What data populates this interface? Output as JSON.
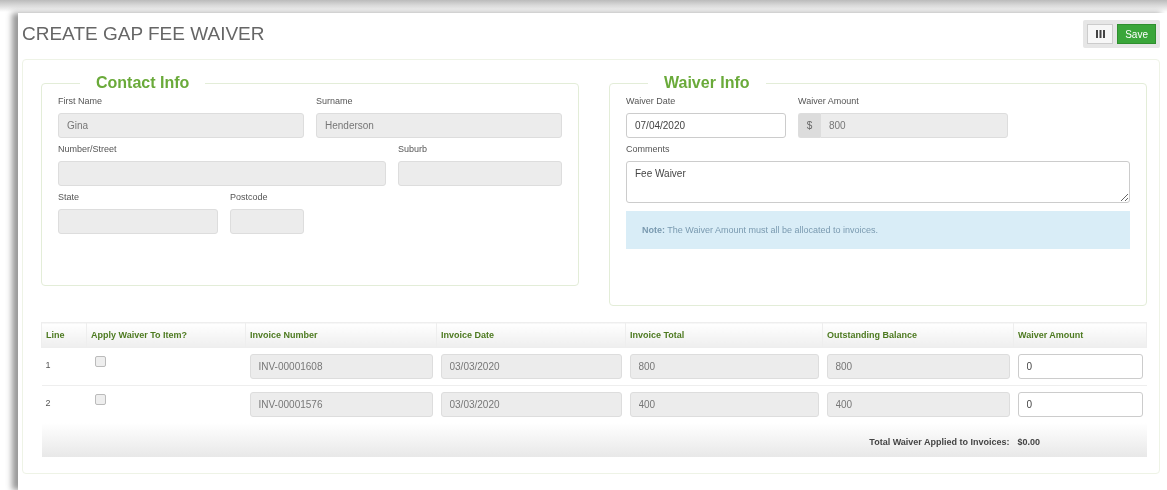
{
  "page_title": "CREATE GAP FEE WAIVER",
  "toolbar": {
    "buttons": [
      {
        "kind": "icon"
      },
      {
        "kind": "text",
        "label": "Save"
      }
    ]
  },
  "contact_info": {
    "legend": "Contact Info",
    "rows": [
      [
        {
          "label": "First Name",
          "value": "Gina",
          "disabled": true
        },
        {
          "label": "Surname",
          "value": "Henderson",
          "disabled": true
        }
      ],
      [
        {
          "label": "Number/Street",
          "disabled": true
        },
        {
          "label": "Suburb",
          "disabled": true
        }
      ],
      [
        {
          "label": "State",
          "disabled": true
        },
        {
          "label": "Postcode",
          "disabled": true
        }
      ]
    ]
  },
  "waiver_info": {
    "legend": "Waiver Info",
    "waiver_date": {
      "label": "Waiver Date",
      "value": "07/04/2020",
      "disabled": false
    },
    "waiver_amount": {
      "label": "Waiver Amount",
      "prefix": "$",
      "value": "800",
      "disabled": true
    },
    "comments": {
      "label": "Comments",
      "value": "Fee Waiver",
      "disabled": false
    },
    "note": "**Note:** The Waiver Amount must all be allocated to invoices."
  },
  "table": {
    "columns": [
      "Line",
      "Apply Waiver To Item?",
      "Invoice Number",
      "Invoice Date",
      "Invoice Total",
      "Outstanding Balance",
      "Waiver Amount"
    ],
    "rows": [
      {
        "cells": [
          {
            "kind": "text",
            "value": "1"
          },
          {
            "kind": "checkbox",
            "checked": false
          },
          {
            "kind": "input",
            "value": "INV-00001608",
            "disabled": true
          },
          {
            "kind": "input",
            "value": "03/03/2020",
            "disabled": true
          },
          {
            "kind": "input",
            "value": "800",
            "disabled": true
          },
          {
            "kind": "input",
            "value": "800",
            "disabled": true
          },
          {
            "kind": "input",
            "value": "0",
            "disabled": false
          }
        ]
      },
      {
        "cells": [
          {
            "kind": "text",
            "value": "2"
          },
          {
            "kind": "checkbox",
            "checked": false
          },
          {
            "kind": "input",
            "value": "INV-00001576",
            "disabled": true
          },
          {
            "kind": "input",
            "value": "03/03/2020",
            "disabled": true
          },
          {
            "kind": "input",
            "value": "400",
            "disabled": true
          },
          {
            "kind": "input",
            "value": "400",
            "disabled": true
          },
          {
            "kind": "input",
            "value": "0",
            "disabled": false
          }
        ]
      }
    ],
    "footer": {
      "label": "Total Waiver Applied to Invoices:",
      "value": "$0.00"
    }
  }
}
